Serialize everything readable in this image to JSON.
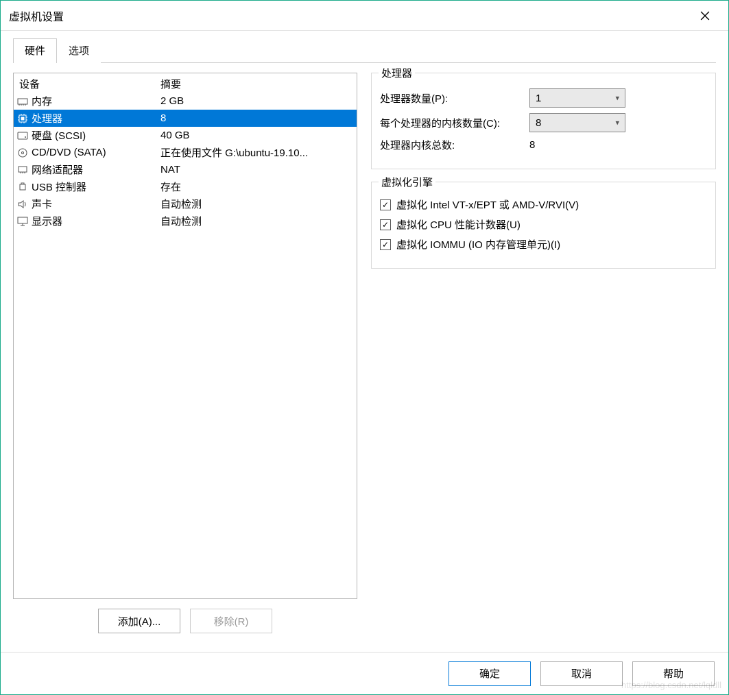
{
  "window": {
    "title": "虚拟机设置"
  },
  "tabs": {
    "hardware": "硬件",
    "options": "选项"
  },
  "list": {
    "head_device": "设备",
    "head_summary": "摘要",
    "rows": [
      {
        "icon": "memory-icon",
        "name": "内存",
        "summary": "2 GB"
      },
      {
        "icon": "cpu-icon",
        "name": "处理器",
        "summary": "8"
      },
      {
        "icon": "disk-icon",
        "name": "硬盘 (SCSI)",
        "summary": "40 GB"
      },
      {
        "icon": "cd-icon",
        "name": "CD/DVD (SATA)",
        "summary": "正在使用文件 G:\\ubuntu-19.10..."
      },
      {
        "icon": "nic-icon",
        "name": "网络适配器",
        "summary": "NAT"
      },
      {
        "icon": "usb-icon",
        "name": "USB 控制器",
        "summary": "存在"
      },
      {
        "icon": "sound-icon",
        "name": "声卡",
        "summary": "自动检测"
      },
      {
        "icon": "display-icon",
        "name": "显示器",
        "summary": "自动检测"
      }
    ]
  },
  "btns": {
    "add": "添加(A)...",
    "remove": "移除(R)"
  },
  "proc": {
    "group_title": "处理器",
    "count_label": "处理器数量(P):",
    "count_value": "1",
    "cores_label": "每个处理器的内核数量(C):",
    "cores_value": "8",
    "total_label": "处理器内核总数:",
    "total_value": "8"
  },
  "virt": {
    "group_title": "虚拟化引擎",
    "opt1": "虚拟化 Intel VT-x/EPT 或 AMD-V/RVI(V)",
    "opt2": "虚拟化 CPU 性能计数器(U)",
    "opt3": "虚拟化 IOMMU (IO 内存管理单元)(I)"
  },
  "footer": {
    "ok": "确定",
    "cancel": "取消",
    "help": "帮助"
  },
  "watermark": "https://blog.csdn.net/lqldll"
}
